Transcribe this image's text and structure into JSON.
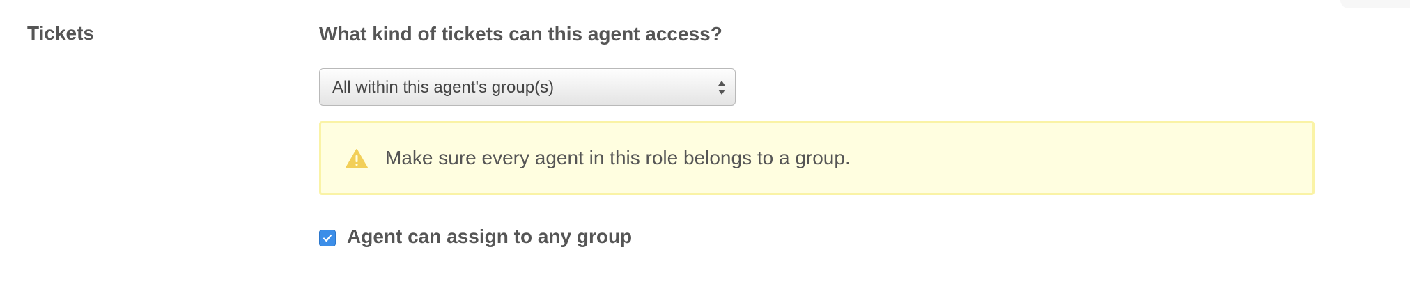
{
  "section": {
    "label": "Tickets"
  },
  "ticket_access": {
    "question": "What kind of tickets can this agent access?",
    "select": {
      "selected": "All within this agent's group(s)"
    }
  },
  "warning": {
    "icon": "warning-icon",
    "text": "Make sure every agent in this role belongs to a group."
  },
  "assign_option": {
    "checked": true,
    "label": "Agent can assign to any group"
  },
  "colors": {
    "checkbox_accent": "#3c8ee8",
    "warning_background": "#fffee0",
    "warning_border": "#faf3a6",
    "warning_icon": "#f2cf58",
    "text": "#555555"
  }
}
